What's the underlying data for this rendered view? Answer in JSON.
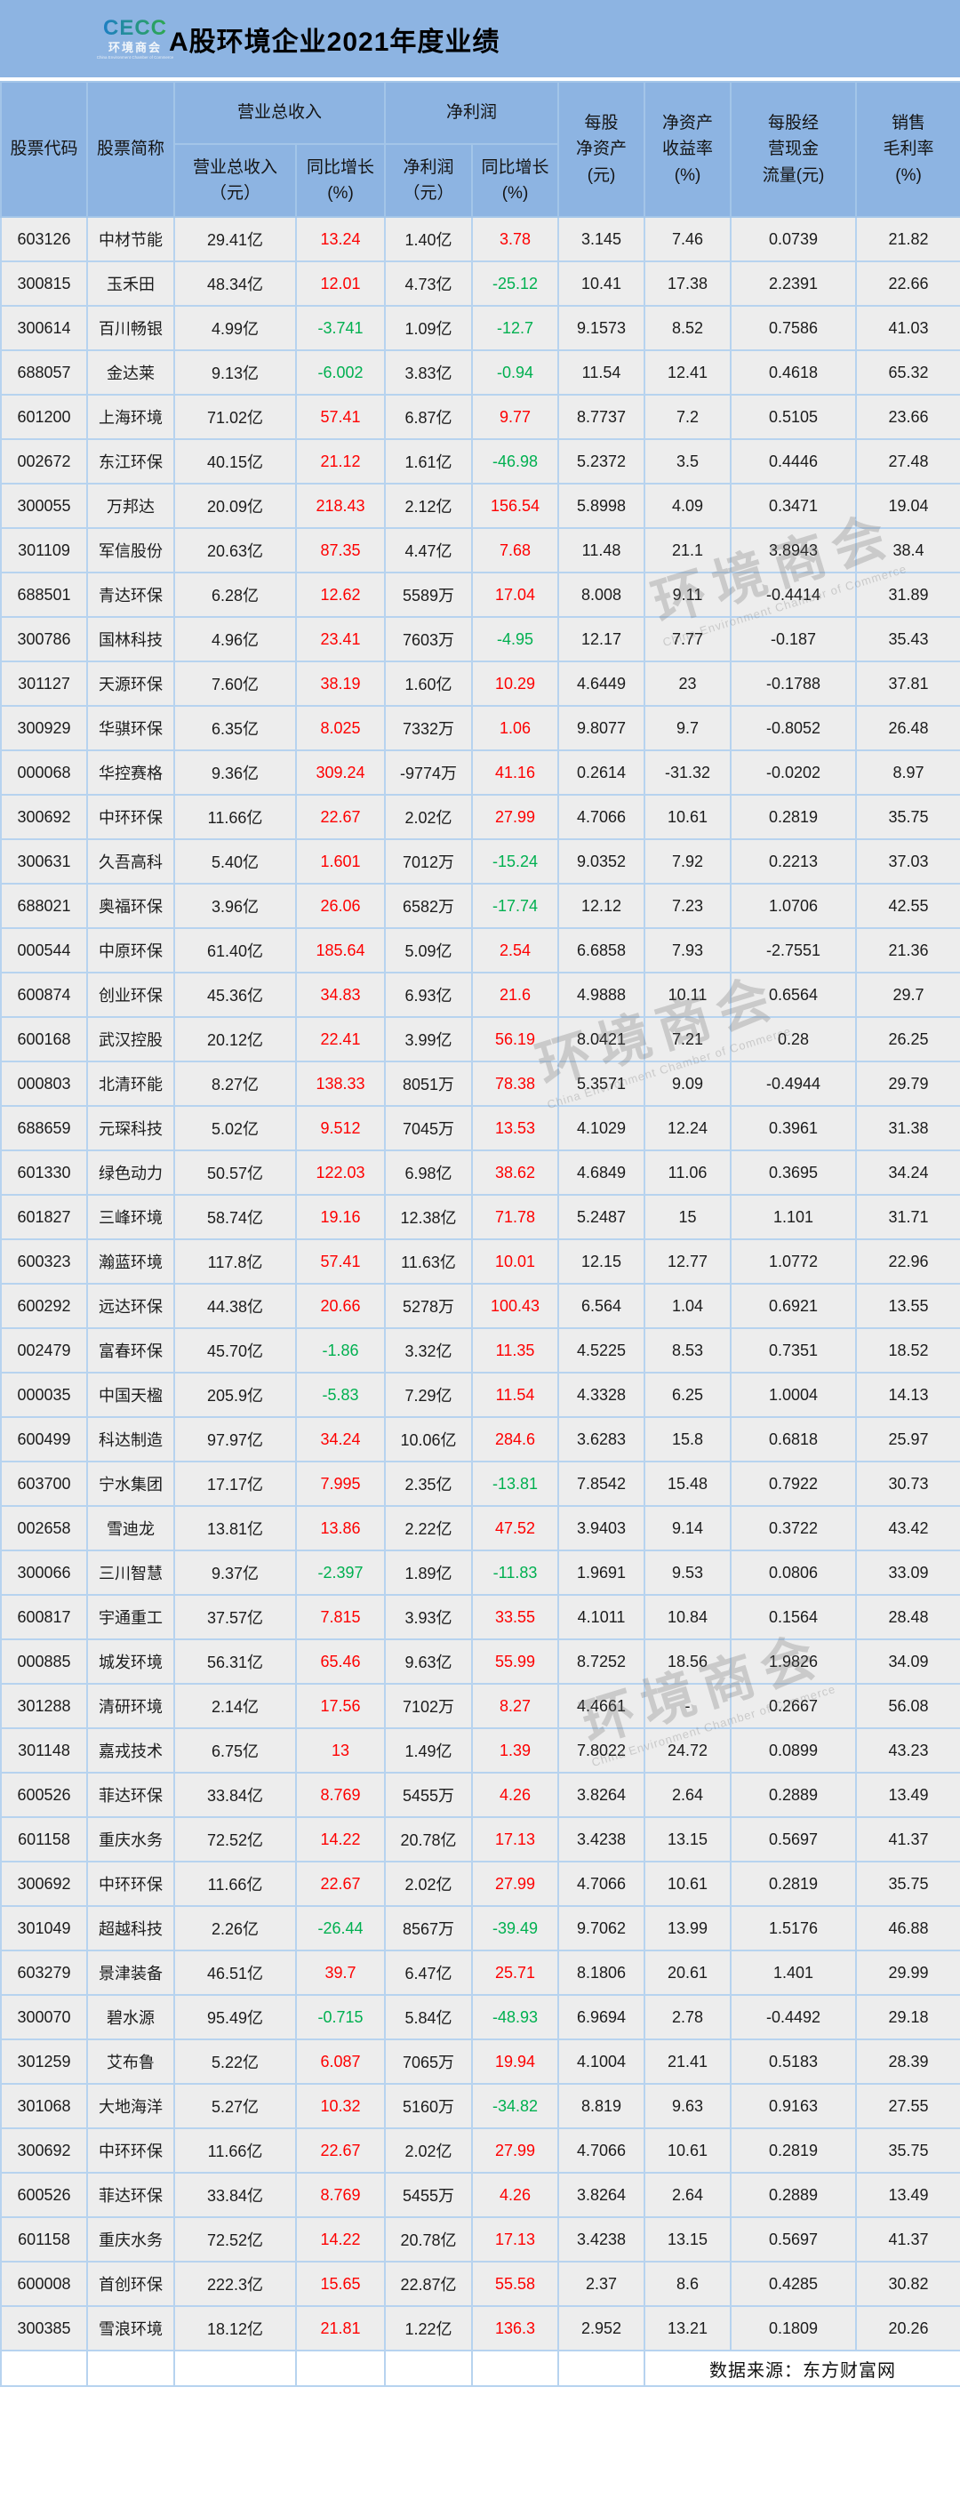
{
  "banner": {
    "logo": {
      "acronym": "CECC",
      "name_cn": "环境商会",
      "name_en": "China Environment Chamber of Commerce"
    },
    "title": "A股环境企业2021年度业绩"
  },
  "watermark": {
    "text_cn": "环境商会",
    "text_en": "China Environment Chamber of Commerce"
  },
  "colors": {
    "header_bg": "#8db4e2",
    "row_bg": "#ededed",
    "grid_line": "#b7d3ef",
    "positive_growth": "#fe0000",
    "negative_growth": "#00b050"
  },
  "table": {
    "header": {
      "stock_code": "股票代码",
      "stock_name": "股票简称",
      "revenue_group": "营业总收入",
      "profit_group": "净利润",
      "revenue_sub": "营业总收入\n（元）",
      "revenue_growth_sub": "同比增长\n(%)",
      "profit_sub": "净利润\n（元）",
      "profit_growth_sub": "同比增长\n(%)",
      "bps": "每股\n净资产\n(元)",
      "roe": "净资产\n收益率\n(%)",
      "ocf": "每股经\n营现金\n流量(元)",
      "margin": "销售\n毛利率\n(%)"
    },
    "rows": [
      [
        "603126",
        "中材节能",
        "29.41亿",
        "13.24",
        "1.40亿",
        "3.78",
        "3.145",
        "7.46",
        "0.0739",
        "21.82"
      ],
      [
        "300815",
        "玉禾田",
        "48.34亿",
        "12.01",
        "4.73亿",
        "-25.12",
        "10.41",
        "17.38",
        "2.2391",
        "22.66"
      ],
      [
        "300614",
        "百川畅银",
        "4.99亿",
        "-3.741",
        "1.09亿",
        "-12.7",
        "9.1573",
        "8.52",
        "0.7586",
        "41.03"
      ],
      [
        "688057",
        "金达莱",
        "9.13亿",
        "-6.002",
        "3.83亿",
        "-0.94",
        "11.54",
        "12.41",
        "0.4618",
        "65.32"
      ],
      [
        "601200",
        "上海环境",
        "71.02亿",
        "57.41",
        "6.87亿",
        "9.77",
        "8.7737",
        "7.2",
        "0.5105",
        "23.66"
      ],
      [
        "002672",
        "东江环保",
        "40.15亿",
        "21.12",
        "1.61亿",
        "-46.98",
        "5.2372",
        "3.5",
        "0.4446",
        "27.48"
      ],
      [
        "300055",
        "万邦达",
        "20.09亿",
        "218.43",
        "2.12亿",
        "156.54",
        "5.8998",
        "4.09",
        "0.3471",
        "19.04"
      ],
      [
        "301109",
        "军信股份",
        "20.63亿",
        "87.35",
        "4.47亿",
        "7.68",
        "11.48",
        "21.1",
        "3.8943",
        "38.4"
      ],
      [
        "688501",
        "青达环保",
        "6.28亿",
        "12.62",
        "5589万",
        "17.04",
        "8.008",
        "9.11",
        "-0.4414",
        "31.89"
      ],
      [
        "300786",
        "国林科技",
        "4.96亿",
        "23.41",
        "7603万",
        "-4.95",
        "12.17",
        "7.77",
        "-0.187",
        "35.43"
      ],
      [
        "301127",
        "天源环保",
        "7.60亿",
        "38.19",
        "1.60亿",
        "10.29",
        "4.6449",
        "23",
        "-0.1788",
        "37.81"
      ],
      [
        "300929",
        "华骐环保",
        "6.35亿",
        "8.025",
        "7332万",
        "1.06",
        "9.8077",
        "9.7",
        "-0.8052",
        "26.48"
      ],
      [
        "000068",
        "华控赛格",
        "9.36亿",
        "309.24",
        "-9774万",
        "41.16",
        "0.2614",
        "-31.32",
        "-0.0202",
        "8.97"
      ],
      [
        "300692",
        "中环环保",
        "11.66亿",
        "22.67",
        "2.02亿",
        "27.99",
        "4.7066",
        "10.61",
        "0.2819",
        "35.75"
      ],
      [
        "300631",
        "久吾高科",
        "5.40亿",
        "1.601",
        "7012万",
        "-15.24",
        "9.0352",
        "7.92",
        "0.2213",
        "37.03"
      ],
      [
        "688021",
        "奥福环保",
        "3.96亿",
        "26.06",
        "6582万",
        "-17.74",
        "12.12",
        "7.23",
        "1.0706",
        "42.55"
      ],
      [
        "000544",
        "中原环保",
        "61.40亿",
        "185.64",
        "5.09亿",
        "2.54",
        "6.6858",
        "7.93",
        "-2.7551",
        "21.36"
      ],
      [
        "600874",
        "创业环保",
        "45.36亿",
        "34.83",
        "6.93亿",
        "21.6",
        "4.9888",
        "10.11",
        "0.6564",
        "29.7"
      ],
      [
        "600168",
        "武汉控股",
        "20.12亿",
        "22.41",
        "3.99亿",
        "56.19",
        "8.0421",
        "7.21",
        "0.28",
        "26.25"
      ],
      [
        "000803",
        "北清环能",
        "8.27亿",
        "138.33",
        "8051万",
        "78.38",
        "5.3571",
        "9.09",
        "-0.4944",
        "29.79"
      ],
      [
        "688659",
        "元琛科技",
        "5.02亿",
        "9.512",
        "7045万",
        "13.53",
        "4.1029",
        "12.24",
        "0.3961",
        "31.38"
      ],
      [
        "601330",
        "绿色动力",
        "50.57亿",
        "122.03",
        "6.98亿",
        "38.62",
        "4.6849",
        "11.06",
        "0.3695",
        "34.24"
      ],
      [
        "601827",
        "三峰环境",
        "58.74亿",
        "19.16",
        "12.38亿",
        "71.78",
        "5.2487",
        "15",
        "1.101",
        "31.71"
      ],
      [
        "600323",
        "瀚蓝环境",
        "117.8亿",
        "57.41",
        "11.63亿",
        "10.01",
        "12.15",
        "12.77",
        "1.0772",
        "22.96"
      ],
      [
        "600292",
        "远达环保",
        "44.38亿",
        "20.66",
        "5278万",
        "100.43",
        "6.564",
        "1.04",
        "0.6921",
        "13.55"
      ],
      [
        "002479",
        "富春环保",
        "45.70亿",
        "-1.86",
        "3.32亿",
        "11.35",
        "4.5225",
        "8.53",
        "0.7351",
        "18.52"
      ],
      [
        "000035",
        "中国天楹",
        "205.9亿",
        "-5.83",
        "7.29亿",
        "11.54",
        "4.3328",
        "6.25",
        "1.0004",
        "14.13"
      ],
      [
        "600499",
        "科达制造",
        "97.97亿",
        "34.24",
        "10.06亿",
        "284.6",
        "3.6283",
        "15.8",
        "0.6818",
        "25.97"
      ],
      [
        "603700",
        "宁水集团",
        "17.17亿",
        "7.995",
        "2.35亿",
        "-13.81",
        "7.8542",
        "15.48",
        "0.7922",
        "30.73"
      ],
      [
        "002658",
        "雪迪龙",
        "13.81亿",
        "13.86",
        "2.22亿",
        "47.52",
        "3.9403",
        "9.14",
        "0.3722",
        "43.42"
      ],
      [
        "300066",
        "三川智慧",
        "9.37亿",
        "-2.397",
        "1.89亿",
        "-11.83",
        "1.9691",
        "9.53",
        "0.0806",
        "33.09"
      ],
      [
        "600817",
        "宇通重工",
        "37.57亿",
        "7.815",
        "3.93亿",
        "33.55",
        "4.1011",
        "10.84",
        "0.1564",
        "28.48"
      ],
      [
        "000885",
        "城发环境",
        "56.31亿",
        "65.46",
        "9.63亿",
        "55.99",
        "8.7252",
        "18.56",
        "1.9826",
        "34.09"
      ],
      [
        "301288",
        "清研环境",
        "2.14亿",
        "17.56",
        "7102万",
        "8.27",
        "4.4661",
        "-",
        "0.2667",
        "56.08"
      ],
      [
        "301148",
        "嘉戎技术",
        "6.75亿",
        "13",
        "1.49亿",
        "1.39",
        "7.8022",
        "24.72",
        "0.0899",
        "43.23"
      ],
      [
        "600526",
        "菲达环保",
        "33.84亿",
        "8.769",
        "5455万",
        "4.26",
        "3.8264",
        "2.64",
        "0.2889",
        "13.49"
      ],
      [
        "601158",
        "重庆水务",
        "72.52亿",
        "14.22",
        "20.78亿",
        "17.13",
        "3.4238",
        "13.15",
        "0.5697",
        "41.37"
      ],
      [
        "300692",
        "中环环保",
        "11.66亿",
        "22.67",
        "2.02亿",
        "27.99",
        "4.7066",
        "10.61",
        "0.2819",
        "35.75"
      ],
      [
        "301049",
        "超越科技",
        "2.26亿",
        "-26.44",
        "8567万",
        "-39.49",
        "9.7062",
        "13.99",
        "1.5176",
        "46.88"
      ],
      [
        "603279",
        "景津装备",
        "46.51亿",
        "39.7",
        "6.47亿",
        "25.71",
        "8.1806",
        "20.61",
        "1.401",
        "29.99"
      ],
      [
        "300070",
        "碧水源",
        "95.49亿",
        "-0.715",
        "5.84亿",
        "-48.93",
        "6.9694",
        "2.78",
        "-0.4492",
        "29.18"
      ],
      [
        "301259",
        "艾布鲁",
        "5.22亿",
        "6.087",
        "7065万",
        "19.94",
        "4.1004",
        "21.41",
        "0.5183",
        "28.39"
      ],
      [
        "301068",
        "大地海洋",
        "5.27亿",
        "10.32",
        "5160万",
        "-34.82",
        "8.819",
        "9.63",
        "0.9163",
        "27.55"
      ],
      [
        "300692",
        "中环环保",
        "11.66亿",
        "22.67",
        "2.02亿",
        "27.99",
        "4.7066",
        "10.61",
        "0.2819",
        "35.75"
      ],
      [
        "600526",
        "菲达环保",
        "33.84亿",
        "8.769",
        "5455万",
        "4.26",
        "3.8264",
        "2.64",
        "0.2889",
        "13.49"
      ],
      [
        "601158",
        "重庆水务",
        "72.52亿",
        "14.22",
        "20.78亿",
        "17.13",
        "3.4238",
        "13.15",
        "0.5697",
        "41.37"
      ],
      [
        "600008",
        "首创环保",
        "222.3亿",
        "15.65",
        "22.87亿",
        "55.58",
        "2.37",
        "8.6",
        "0.4285",
        "30.82"
      ],
      [
        "300385",
        "雪浪环境",
        "18.12亿",
        "21.81",
        "1.22亿",
        "136.3",
        "2.952",
        "13.21",
        "0.1809",
        "20.26"
      ]
    ],
    "footer_note": "数据来源：东方财富网"
  }
}
